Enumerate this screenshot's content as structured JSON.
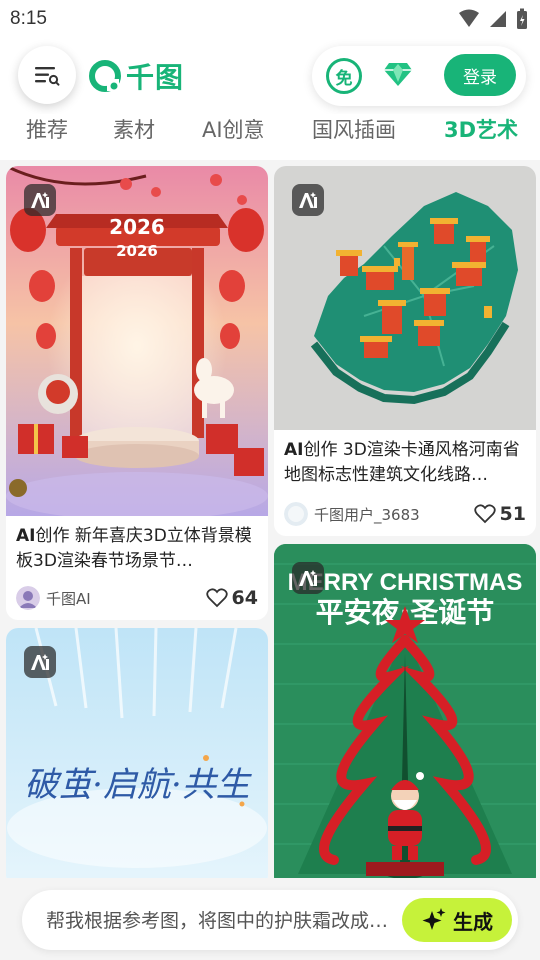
{
  "status": {
    "time": "8:15"
  },
  "header": {
    "logo_text": "千图",
    "free_label": "免",
    "login_label": "登录"
  },
  "tabs": [
    {
      "label": "推荐",
      "active": false
    },
    {
      "label": "素材",
      "active": false
    },
    {
      "label": "AI创意",
      "active": false
    },
    {
      "label": "国风插画",
      "active": false
    },
    {
      "label": "3D艺术",
      "active": true
    }
  ],
  "cards": [
    {
      "image_text": [
        "2026",
        "2026"
      ],
      "title_prefix": "AI",
      "title_rest": "创作 新年喜庆3D立体背景模板3D渲染春节场景节…",
      "author": "千图AI",
      "likes": "64"
    },
    {
      "image_text": [],
      "title_prefix": "AI",
      "title_rest": "创作 3D渲染卡通风格河南省地图标志性建筑文化线路…",
      "author": "千图用户_3683",
      "likes": "51"
    },
    {
      "image_text": [
        "破茧·启航·共生"
      ],
      "title_prefix": "",
      "title_rest": "",
      "author": "",
      "likes": ""
    },
    {
      "image_text": [
        "MERRY CHRISTMAS",
        "平安夜·圣诞节"
      ],
      "title_prefix": "",
      "title_rest": "",
      "author": "",
      "likes": ""
    }
  ],
  "prompt": {
    "text": "帮我根据参考图，将图中的护肤霜改成…",
    "generate_label": "生成"
  },
  "colors": {
    "brand": "#18b478",
    "generate": "#c6f23a"
  }
}
